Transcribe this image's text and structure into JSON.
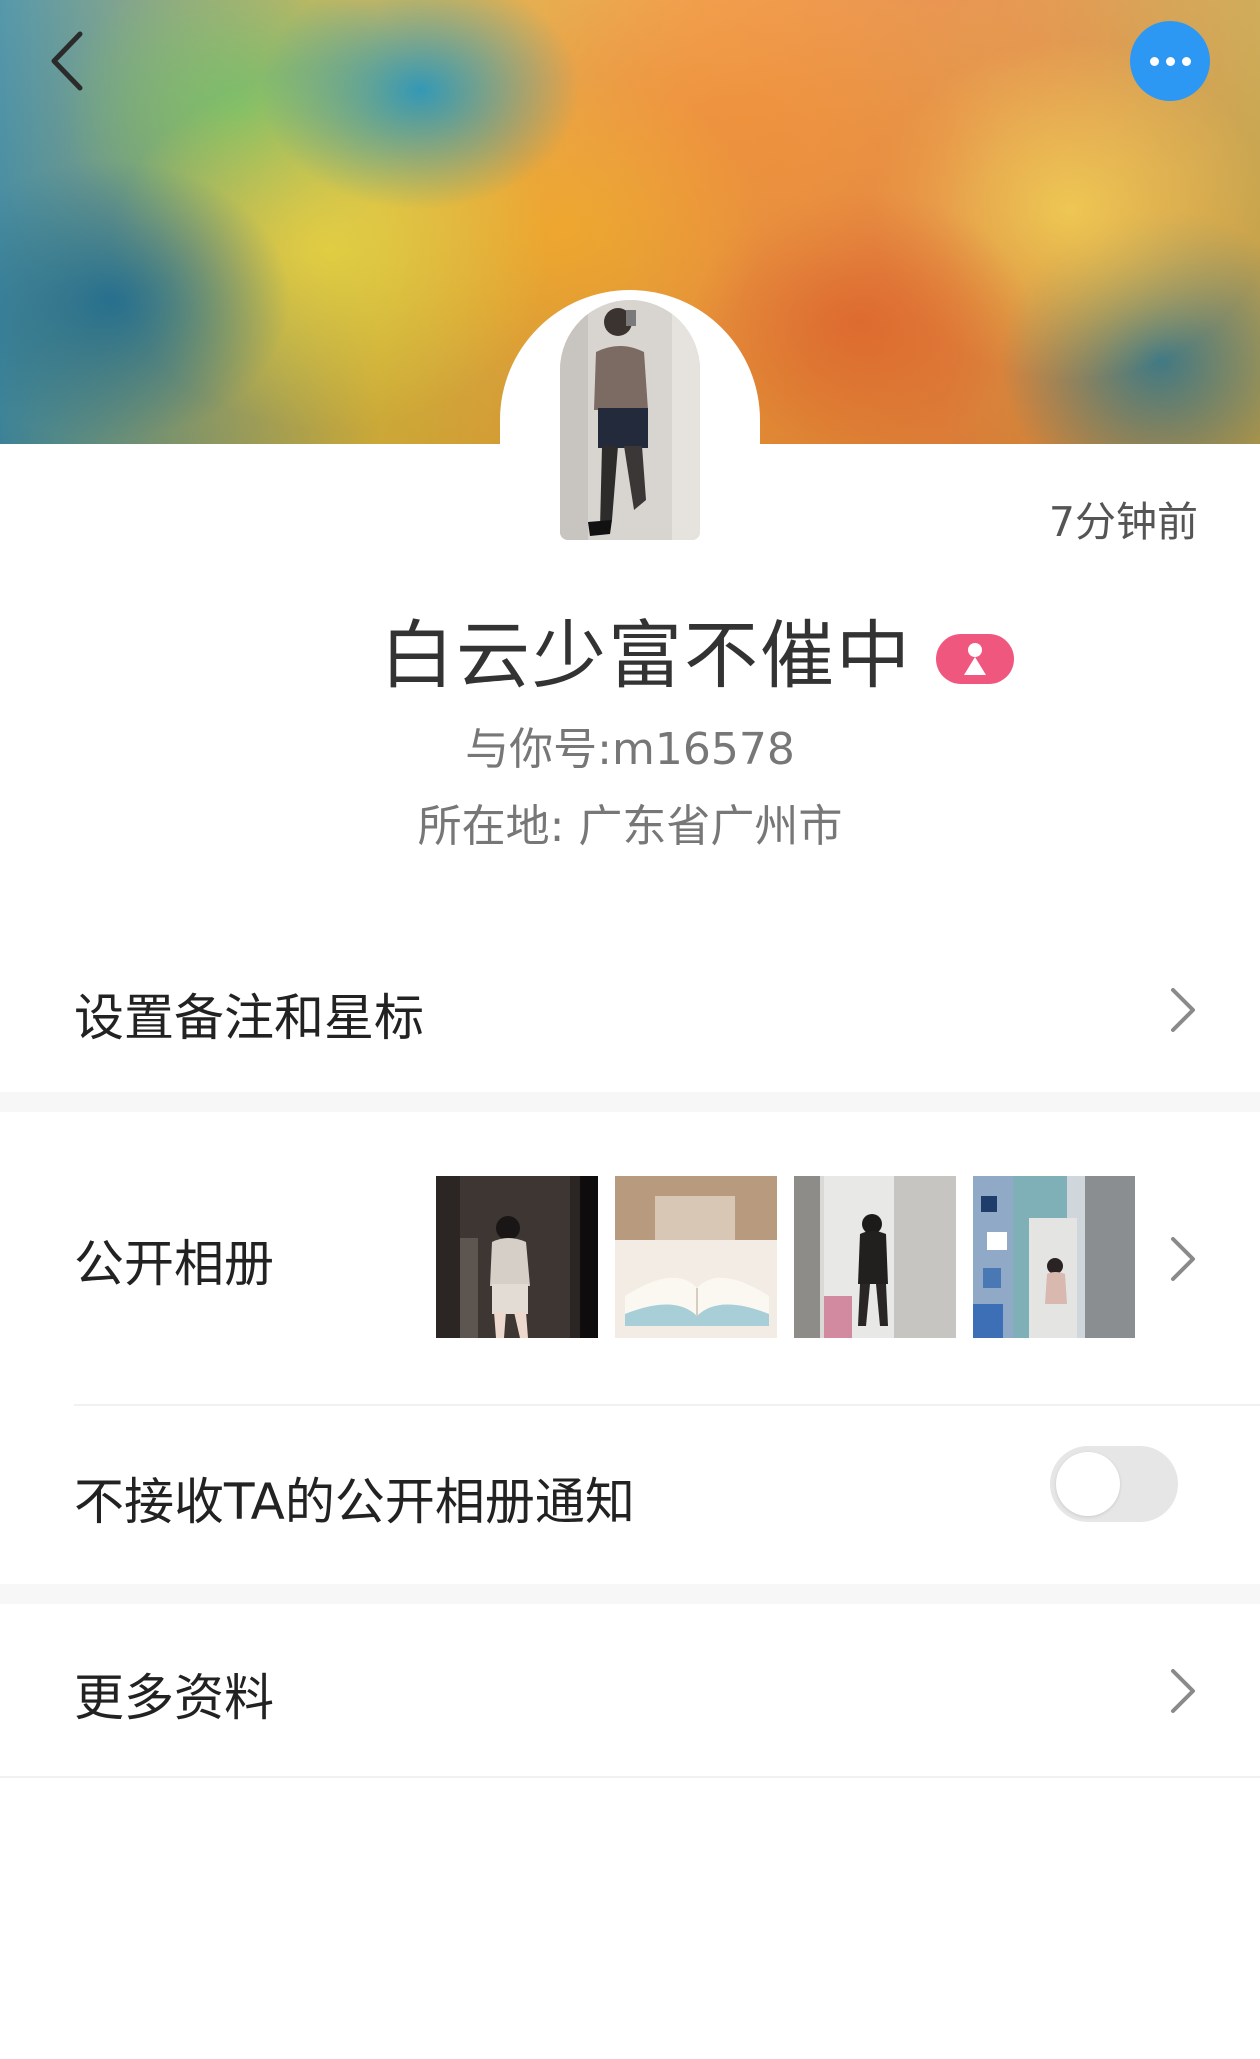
{
  "header": {
    "back_icon": "chevron-left-icon",
    "more_icon": "ellipsis-icon",
    "more_button_color": "#2d98f3"
  },
  "profile": {
    "last_seen": "7分钟前",
    "name": "白云少富不催中",
    "gender_icon": "female-person-icon",
    "gender_badge_color": "#f0577f",
    "account_id": "与你号:m16578",
    "location": "所在地: 广东省广州市"
  },
  "menu": {
    "remark_label": "设置备注和星标",
    "album_label": "公开相册",
    "album_thumbnails": [
      "photo-1",
      "photo-2",
      "photo-3",
      "photo-4"
    ],
    "notify_label": "不接收TA的公开相册通知",
    "notify_toggle_on": false,
    "more_info_label": "更多资料"
  }
}
